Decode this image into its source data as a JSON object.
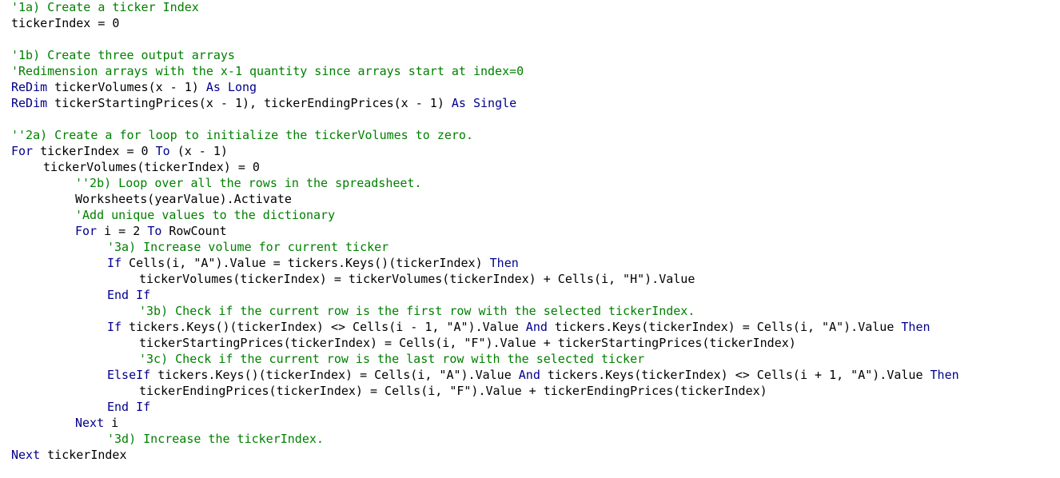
{
  "editor": {
    "colors": {
      "background": "#ffffff",
      "plain": "#000000",
      "comment": "#008000",
      "keyword": "#00008b"
    },
    "lines": [
      {
        "indent": 0,
        "tokens": [
          {
            "t": "comment",
            "v": "'1a) Create a ticker Index"
          }
        ]
      },
      {
        "indent": 0,
        "tokens": [
          {
            "t": "plain",
            "v": "tickerIndex = 0"
          }
        ]
      },
      null,
      {
        "indent": 0,
        "tokens": [
          {
            "t": "comment",
            "v": "'1b) Create three output arrays"
          }
        ]
      },
      {
        "indent": 0,
        "tokens": [
          {
            "t": "comment",
            "v": "'Redimension arrays with the x-1 quantity since arrays start at index=0"
          }
        ]
      },
      {
        "indent": 0,
        "tokens": [
          {
            "t": "keyword",
            "v": "ReDim"
          },
          {
            "t": "plain",
            "v": " tickerVolumes(x - 1) "
          },
          {
            "t": "keyword",
            "v": "As"
          },
          {
            "t": "plain",
            "v": " "
          },
          {
            "t": "keyword",
            "v": "Long"
          }
        ]
      },
      {
        "indent": 0,
        "tokens": [
          {
            "t": "keyword",
            "v": "ReDim"
          },
          {
            "t": "plain",
            "v": " tickerStartingPrices(x - 1), tickerEndingPrices(x - 1) "
          },
          {
            "t": "keyword",
            "v": "As"
          },
          {
            "t": "plain",
            "v": " "
          },
          {
            "t": "keyword",
            "v": "Single"
          }
        ]
      },
      null,
      {
        "indent": 0,
        "tokens": [
          {
            "t": "comment",
            "v": "''2a) Create a for loop to initialize the tickerVolumes to zero."
          }
        ]
      },
      {
        "indent": 0,
        "tokens": [
          {
            "t": "keyword",
            "v": "For"
          },
          {
            "t": "plain",
            "v": " tickerIndex = 0 "
          },
          {
            "t": "keyword",
            "v": "To"
          },
          {
            "t": "plain",
            "v": " (x - 1)"
          }
        ]
      },
      {
        "indent": 1,
        "tokens": [
          {
            "t": "plain",
            "v": "tickerVolumes(tickerIndex) = 0"
          }
        ]
      },
      {
        "indent": 2,
        "tokens": [
          {
            "t": "comment",
            "v": "''2b) Loop over all the rows in the spreadsheet."
          }
        ]
      },
      {
        "indent": 2,
        "tokens": [
          {
            "t": "plain",
            "v": "Worksheets(yearValue).Activate"
          }
        ]
      },
      {
        "indent": 2,
        "tokens": [
          {
            "t": "comment",
            "v": "'Add unique values to the dictionary"
          }
        ]
      },
      {
        "indent": 2,
        "tokens": [
          {
            "t": "keyword",
            "v": "For"
          },
          {
            "t": "plain",
            "v": " i = 2 "
          },
          {
            "t": "keyword",
            "v": "To"
          },
          {
            "t": "plain",
            "v": " RowCount"
          }
        ]
      },
      {
        "indent": 3,
        "tokens": [
          {
            "t": "comment",
            "v": "'3a) Increase volume for current ticker"
          }
        ]
      },
      {
        "indent": 3,
        "tokens": [
          {
            "t": "keyword",
            "v": "If"
          },
          {
            "t": "plain",
            "v": " Cells(i, \"A\").Value = tickers.Keys()(tickerIndex) "
          },
          {
            "t": "keyword",
            "v": "Then"
          }
        ]
      },
      {
        "indent": 4,
        "tokens": [
          {
            "t": "plain",
            "v": "tickerVolumes(tickerIndex) = tickerVolumes(tickerIndex) + Cells(i, \"H\").Value"
          }
        ]
      },
      {
        "indent": 3,
        "tokens": [
          {
            "t": "keyword",
            "v": "End If"
          }
        ]
      },
      {
        "indent": 4,
        "tokens": [
          {
            "t": "comment",
            "v": "'3b) Check if the current row is the first row with the selected tickerIndex."
          }
        ]
      },
      {
        "indent": 3,
        "tokens": [
          {
            "t": "keyword",
            "v": "If"
          },
          {
            "t": "plain",
            "v": " tickers.Keys()(tickerIndex) <> Cells(i - 1, \"A\").Value "
          },
          {
            "t": "keyword",
            "v": "And"
          },
          {
            "t": "plain",
            "v": " tickers.Keys(tickerIndex) = Cells(i, \"A\").Value "
          },
          {
            "t": "keyword",
            "v": "Then"
          }
        ]
      },
      {
        "indent": 4,
        "tokens": [
          {
            "t": "plain",
            "v": "tickerStartingPrices(tickerIndex) = Cells(i, \"F\").Value + tickerStartingPrices(tickerIndex)"
          }
        ]
      },
      {
        "indent": 4,
        "tokens": [
          {
            "t": "comment",
            "v": "'3c) Check if the current row is the last row with the selected ticker"
          }
        ]
      },
      {
        "indent": 3,
        "tokens": [
          {
            "t": "keyword",
            "v": "ElseIf"
          },
          {
            "t": "plain",
            "v": " tickers.Keys()(tickerIndex) = Cells(i, \"A\").Value "
          },
          {
            "t": "keyword",
            "v": "And"
          },
          {
            "t": "plain",
            "v": " tickers.Keys(tickerIndex) <> Cells(i + 1, \"A\").Value "
          },
          {
            "t": "keyword",
            "v": "Then"
          }
        ]
      },
      {
        "indent": 4,
        "tokens": [
          {
            "t": "plain",
            "v": "tickerEndingPrices(tickerIndex) = Cells(i, \"F\").Value + tickerEndingPrices(tickerIndex)"
          }
        ]
      },
      {
        "indent": 3,
        "tokens": [
          {
            "t": "keyword",
            "v": "End If"
          }
        ]
      },
      {
        "indent": 2,
        "tokens": [
          {
            "t": "keyword",
            "v": "Next"
          },
          {
            "t": "plain",
            "v": " i"
          }
        ]
      },
      {
        "indent": 3,
        "tokens": [
          {
            "t": "comment",
            "v": "'3d) Increase the tickerIndex."
          }
        ]
      },
      {
        "indent": 0,
        "tokens": [
          {
            "t": "keyword",
            "v": "Next"
          },
          {
            "t": "plain",
            "v": " tickerIndex"
          }
        ]
      }
    ]
  }
}
